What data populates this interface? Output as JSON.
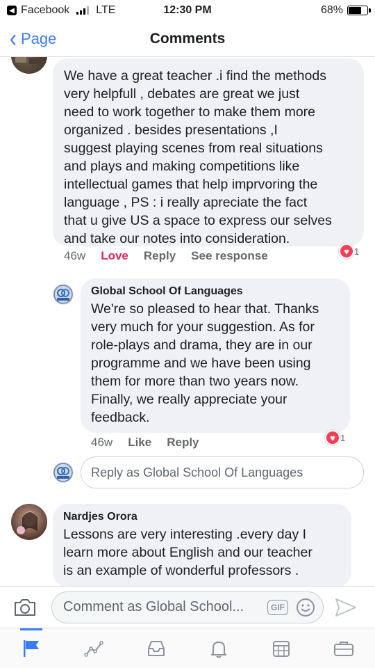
{
  "status_bar": {
    "carrier": "Facebook",
    "network": "LTE",
    "time": "12:30 PM",
    "battery": "68%",
    "battery_level": 0.68
  },
  "nav": {
    "back_label": "Page",
    "title": "Comments"
  },
  "comments": [
    {
      "text": "We have a great teacher .i find the methods\nvery  helpfull , debates are great we just\nneed to work together to make them more\norganized  . besides presentations ,I\nsuggest playing scenes from real situations\nand plays and making competitions  like\nintellectual games that help imprvoring the\nlanguage  , PS : i really apreciate the fact\nthat u give US a space to express our selves\nand take our notes into consideration.",
      "time": "46w",
      "love_label": "Love",
      "reply_label": "Reply",
      "see_response_label": "See response",
      "reaction_count": "1"
    },
    {
      "author": "Global School Of Languages",
      "text": "We're so pleased to hear that. Thanks\nvery much for your suggestion. As for\nrole-plays and drama, they are in our\nprogramme and we have been using\nthem for more than two years now.\nFinally, we really appreciate your\nfeedback.",
      "time": "46w",
      "like_label": "Like",
      "reply_label": "Reply",
      "reaction_count": "1"
    },
    {
      "author": "Nardjes Orora",
      "text": "Lessons are very interesting .every day I\nlearn more about English and our   teacher\nis an example of wonderful professors ."
    }
  ],
  "reply_input": {
    "placeholder": "Reply as Global School Of Languages"
  },
  "composer": {
    "placeholder": "Comment as Global School...",
    "gif_label": "GIF"
  },
  "tab_bar": {
    "items": [
      {
        "icon": "flag-icon",
        "active": true
      },
      {
        "icon": "insights-icon"
      },
      {
        "icon": "inbox-icon"
      },
      {
        "icon": "bell-icon"
      },
      {
        "icon": "calendar-icon"
      },
      {
        "icon": "briefcase-icon"
      }
    ]
  },
  "colors": {
    "accent": "#3b7cf5",
    "love": "#e0245e",
    "bubble": "#f0f1f4"
  }
}
